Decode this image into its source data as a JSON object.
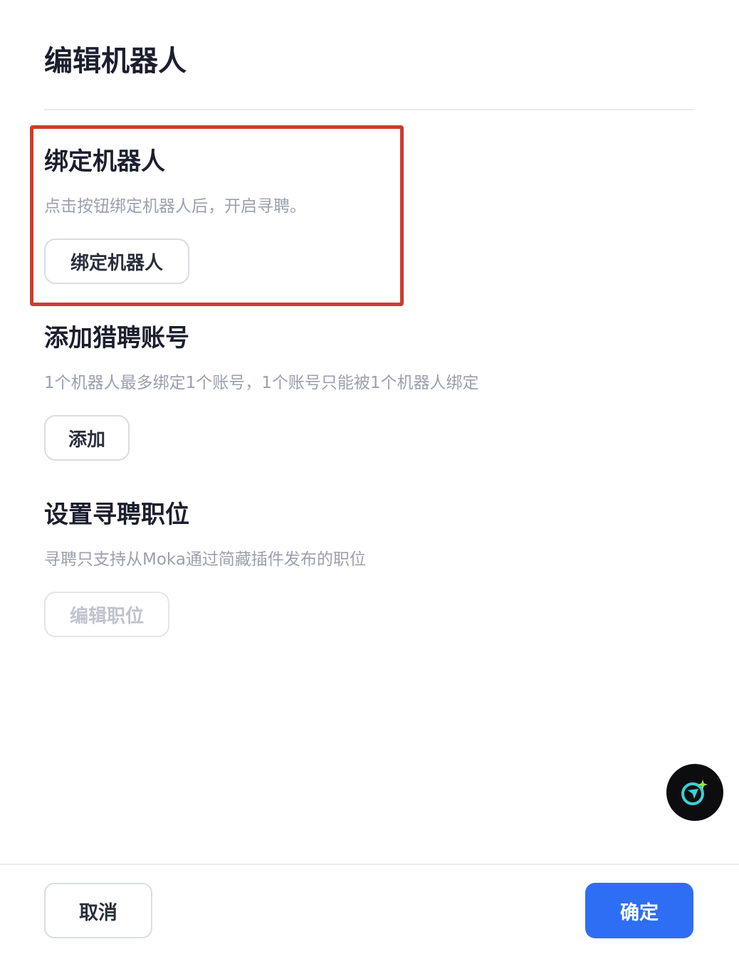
{
  "header": {
    "title": "编辑机器人"
  },
  "sections": [
    {
      "title": "绑定机器人",
      "description": "点击按钮绑定机器人后，开启寻聘。",
      "button_label": "绑定机器人"
    },
    {
      "title": "添加猎聘账号",
      "description": "1个机器人最多绑定1个账号，1个账号只能被1个机器人绑定",
      "button_label": "添加"
    },
    {
      "title": "设置寻聘职位",
      "description": "寻聘只支持从Moka通过简藏插件发布的职位",
      "button_label": "编辑职位",
      "button_disabled": true
    }
  ],
  "footer": {
    "cancel_label": "取消",
    "confirm_label": "确定"
  },
  "icons": {
    "assistant": "ai-assistant-icon"
  },
  "colors": {
    "primary": "#2d6ef5",
    "highlight": "#d13a2c",
    "fab_background": "#0d0d0f",
    "fab_accent": "#3ad0d6"
  }
}
